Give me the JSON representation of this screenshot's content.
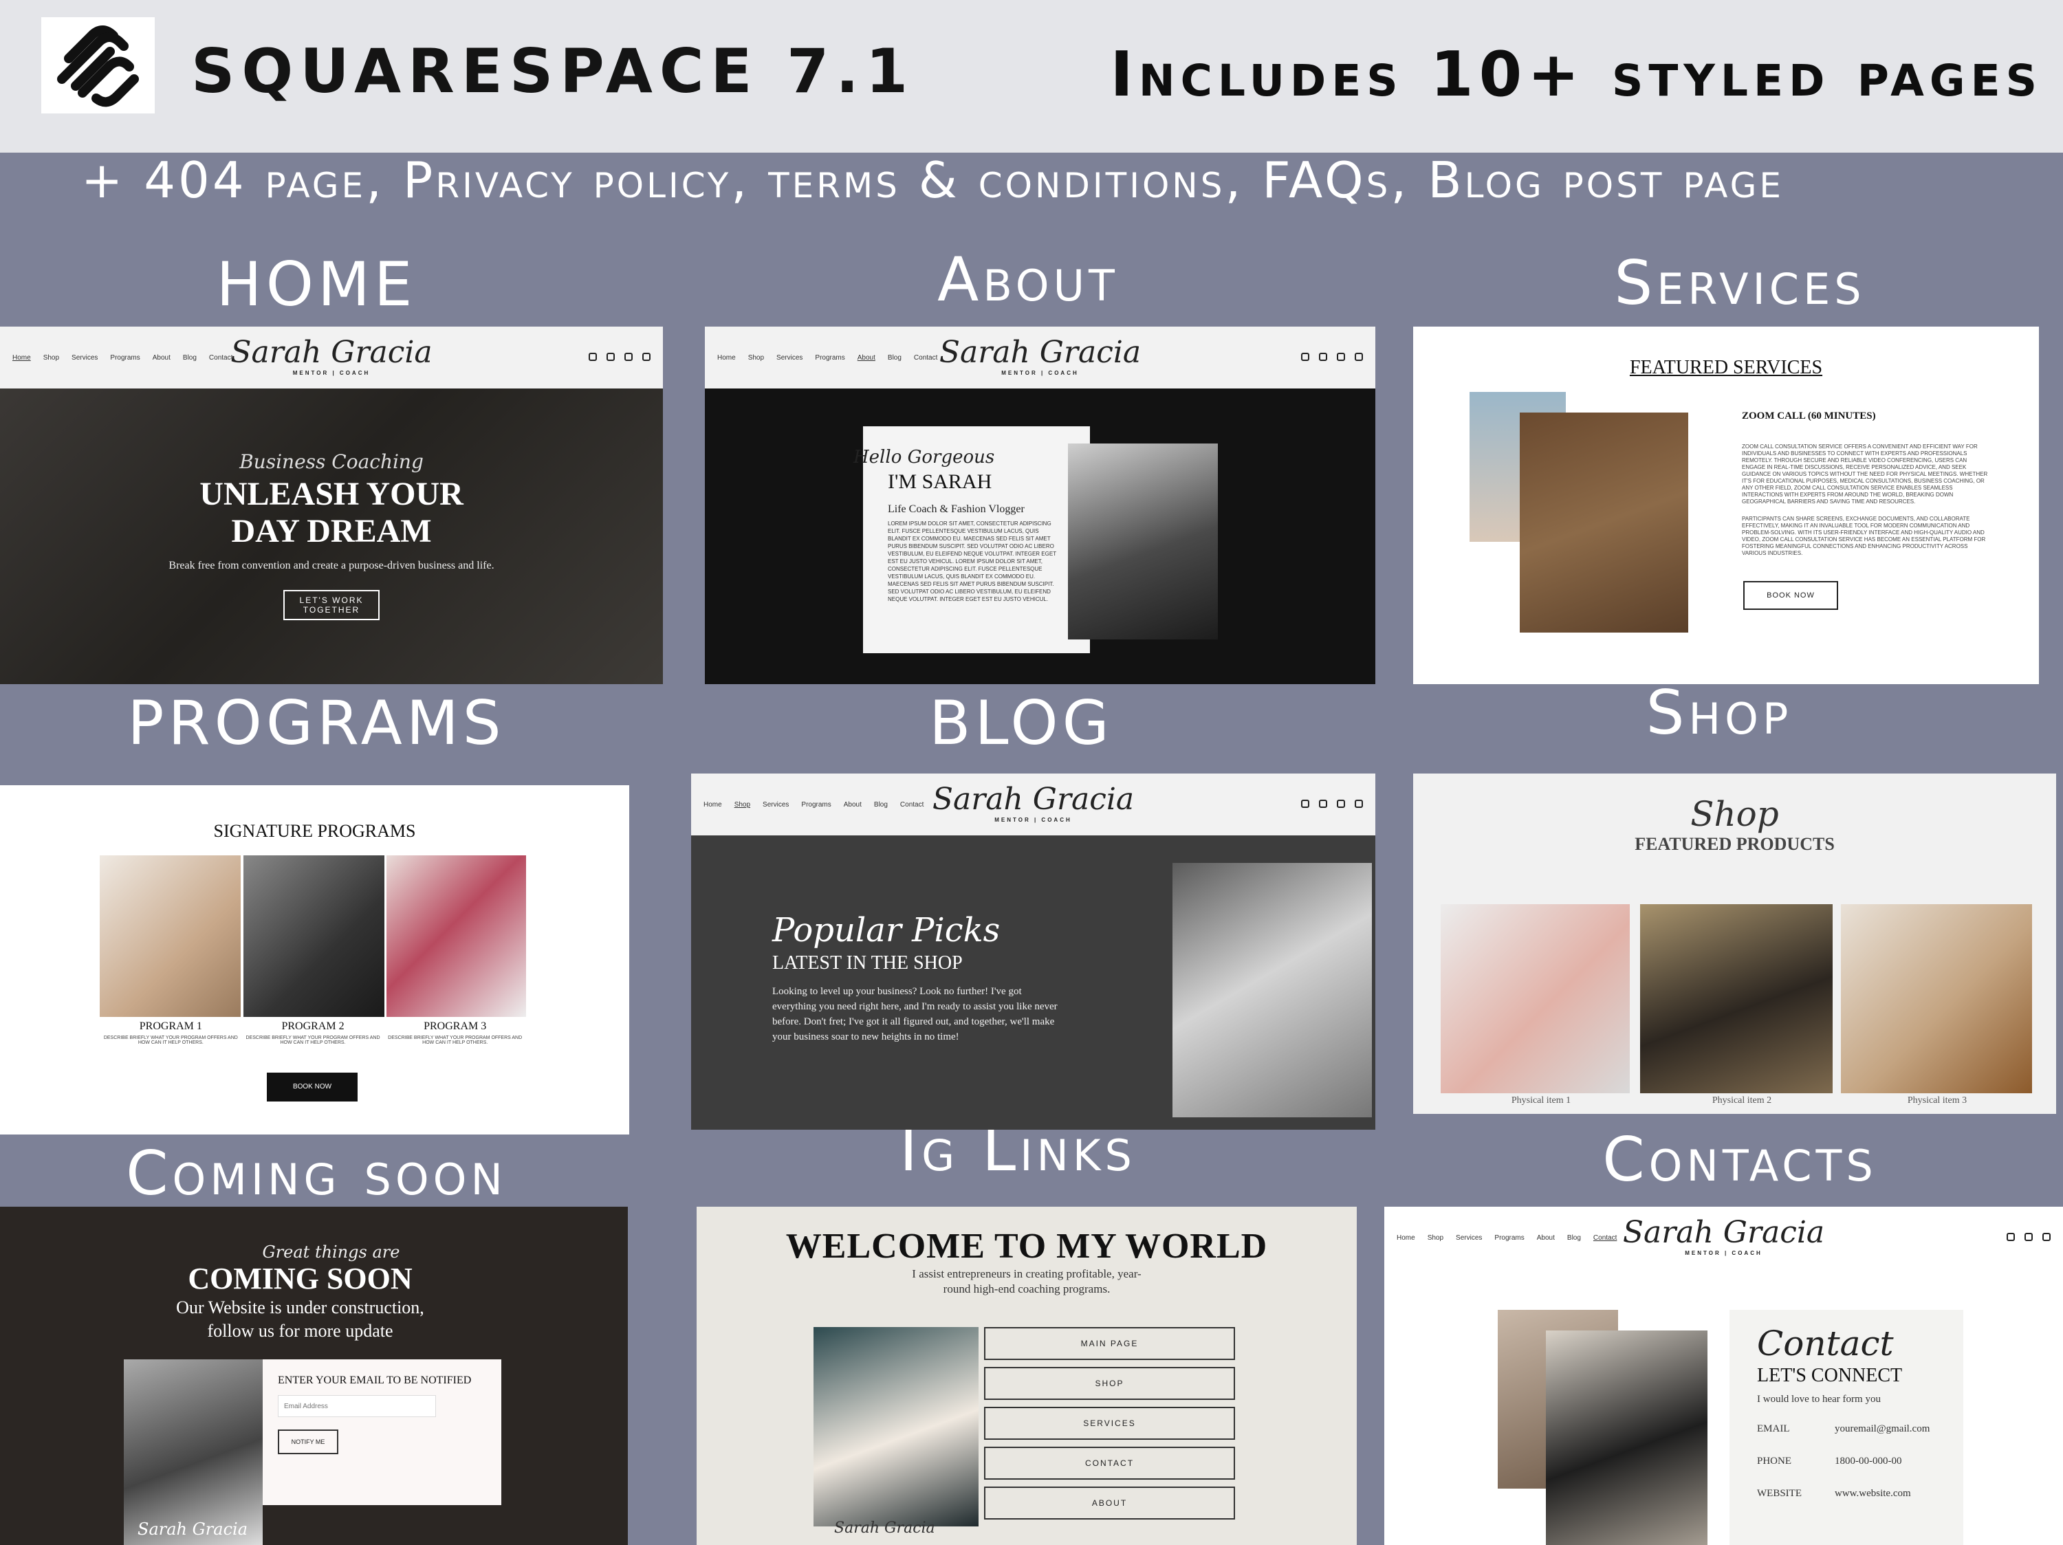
{
  "header": {
    "brand": "SQUARESPACE 7.1",
    "includes": "Includes 10+ styled pages"
  },
  "subtitle": "+ 404 page, Privacy policy, terms & conditions, FAQs, Blog post page",
  "labels": {
    "home": "HOME",
    "about": "About",
    "services": "Services",
    "programs": "PROGRAMS",
    "blog": "BLOG",
    "shop": "Shop",
    "coming": "Coming soon",
    "ig": "Ig Links",
    "contacts": "Contacts"
  },
  "nav": {
    "items": [
      "Home",
      "Shop",
      "Services",
      "Programs",
      "About",
      "Blog",
      "Contact"
    ],
    "logo_script": "Sarah Gracia",
    "logo_sub": "MENTOR | COACH"
  },
  "home": {
    "script": "Business Coaching",
    "title1": "UNLEASH YOUR",
    "title2": "DAY DREAM",
    "body": "Break free from convention and create a purpose-driven business and life.",
    "button": "LET'S WORK TOGETHER"
  },
  "about": {
    "script": "Hello Gorgeous",
    "title": "I'M SARAH",
    "role": "Life Coach & Fashion Vlogger",
    "body": "LOREM IPSUM DOLOR SIT AMET, CONSECTETUR ADIPISCING ELIT. FUSCE PELLENTESQUE VESTIBULUM LACUS, QUIS BLANDIT EX COMMODO EU. MAECENAS SED FELIS SIT AMET PURUS BIBENDUM SUSCIPIT. SED VOLUTPAT ODIO AC LIBERO VESTIBULUM, EU ELEIFEND NEQUE VOLUTPAT. INTEGER EGET EST EU JUSTO VEHICUL. LOREM IPSUM DOLOR SIT AMET, CONSECTETUR ADIPISCING ELIT. FUSCE PELLENTESQUE VESTIBULUM LACUS, QUIS BLANDIT EX COMMODO EU. MAECENAS SED FELIS SIT AMET PURUS BIBENDUM SUSCIPIT. SED VOLUTPAT ODIO AC LIBERO VESTIBULUM, EU ELEIFEND NEQUE VOLUTPAT. INTEGER EGET EST EU JUSTO VEHICUL."
  },
  "services": {
    "title": "FEATURED SERVICES",
    "item": "ZOOM CALL (60 MINUTES)",
    "body1": "ZOOM CALL CONSULTATION SERVICE OFFERS A CONVENIENT AND EFFICIENT WAY FOR INDIVIDUALS AND BUSINESSES TO CONNECT WITH EXPERTS AND PROFESSIONALS REMOTELY. THROUGH SECURE AND RELIABLE VIDEO CONFERENCING, USERS CAN ENGAGE IN REAL-TIME DISCUSSIONS, RECEIVE PERSONALIZED ADVICE, AND SEEK GUIDANCE ON VARIOUS TOPICS WITHOUT THE NEED FOR PHYSICAL MEETINGS. WHETHER IT'S FOR EDUCATIONAL PURPOSES, MEDICAL CONSULTATIONS, BUSINESS COACHING, OR ANY OTHER FIELD, ZOOM CALL CONSULTATION SERVICE ENABLES SEAMLESS INTERACTIONS WITH EXPERTS FROM AROUND THE WORLD, BREAKING DOWN GEOGRAPHICAL BARRIERS AND SAVING TIME AND RESOURCES.",
    "body2": "PARTICIPANTS CAN SHARE SCREENS, EXCHANGE DOCUMENTS, AND COLLABORATE EFFECTIVELY, MAKING IT AN INVALUABLE TOOL FOR MODERN COMMUNICATION AND PROBLEM-SOLVING. WITH ITS USER-FRIENDLY INTERFACE AND HIGH-QUALITY AUDIO AND VIDEO, ZOOM CALL CONSULTATION SERVICE HAS BECOME AN ESSENTIAL PLATFORM FOR FOSTERING MEANINGFUL CONNECTIONS AND ENHANCING PRODUCTIVITY ACROSS VARIOUS INDUSTRIES.",
    "button": "BOOK NOW"
  },
  "programs": {
    "title": "SIGNATURE PROGRAMS",
    "items": [
      {
        "name": "PROGRAM 1",
        "desc": "DESCRIBE BRIEFLY WHAT YOUR PROGRAM OFFERS AND HOW CAN IT HELP OTHERS."
      },
      {
        "name": "PROGRAM 2",
        "desc": "DESCRIBE BRIEFLY WHAT YOUR PROGRAM OFFERS AND HOW CAN IT HELP OTHERS."
      },
      {
        "name": "PROGRAM 3",
        "desc": "DESCRIBE BRIEFLY WHAT YOUR PROGRAM OFFERS AND HOW CAN IT HELP OTHERS."
      }
    ],
    "button": "BOOK NOW"
  },
  "blog": {
    "script": "Popular Picks",
    "title": "LATEST IN THE SHOP",
    "body": "Looking to level up your business? Look no further! I've got everything you need right here, and I'm ready to assist you like never before. Don't fret; I've got it all figured out, and together, we'll make your business soar to new heights in no time!"
  },
  "shop": {
    "script": "Shop",
    "title": "FEATURED PRODUCTS",
    "items": [
      "Physical item 1",
      "Physical item 2",
      "Physical item 3"
    ]
  },
  "coming": {
    "script": "Great things are",
    "title": "COMING SOON",
    "line1": "Our Website is under construction,",
    "line2": "follow us for more update",
    "form_title": "ENTER YOUR EMAIL TO BE NOTIFIED",
    "placeholder": "Email Address",
    "button": "NOTIFY ME",
    "sign": "Sarah Gracia"
  },
  "ig": {
    "title": "WELCOME TO MY WORLD",
    "line1": "I assist entrepreneurs in creating profitable, year-",
    "line2": "round high-end coaching programs.",
    "links": [
      "MAIN PAGE",
      "SHOP",
      "SERVICES",
      "CONTACT",
      "ABOUT"
    ],
    "sign": "Sarah Gracia"
  },
  "contact": {
    "script": "Contact",
    "title": "LET'S CONNECT",
    "line": "I would love to hear form you",
    "rows": [
      {
        "k": "EMAIL",
        "v": "youremail@gmail.com"
      },
      {
        "k": "PHONE",
        "v": "1800-00-000-00"
      },
      {
        "k": "WEBSITE",
        "v": "www.website.com"
      }
    ]
  }
}
